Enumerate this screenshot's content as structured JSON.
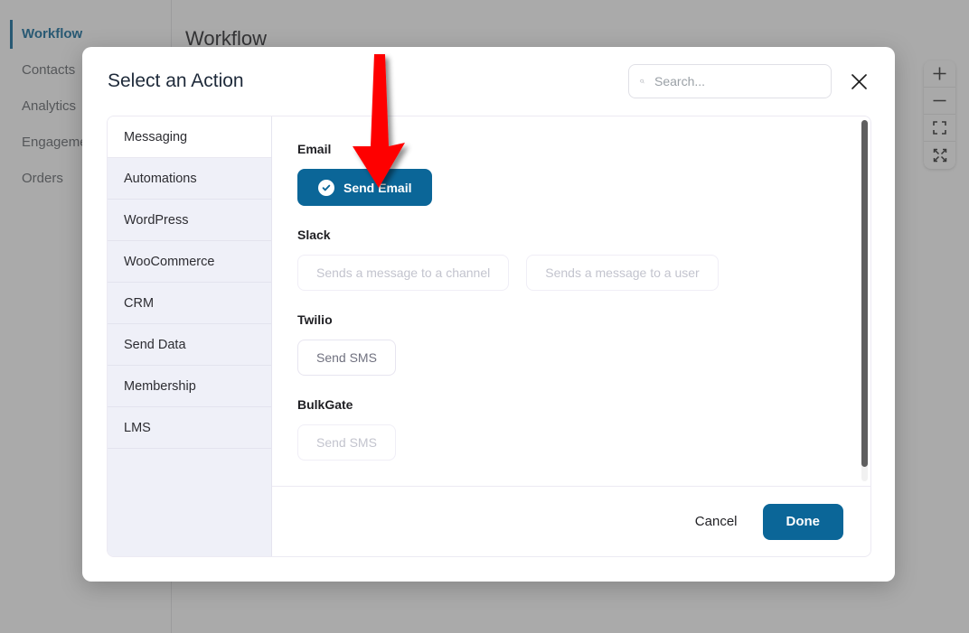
{
  "app": {
    "page_title": "Workflow",
    "sidebar": {
      "items": [
        {
          "label": "Workflow",
          "active": true
        },
        {
          "label": "Contacts",
          "active": false
        },
        {
          "label": "Analytics",
          "active": false
        },
        {
          "label": "Engagement",
          "active": false
        },
        {
          "label": "Orders",
          "active": false
        }
      ]
    },
    "zoom_controls": [
      {
        "name": "zoom-in-icon",
        "glyph": "+"
      },
      {
        "name": "zoom-out-icon",
        "glyph": "−"
      },
      {
        "name": "fit-to-screen-icon",
        "glyph": "⬚"
      },
      {
        "name": "expand-icon",
        "glyph": "⤡"
      }
    ]
  },
  "modal": {
    "title": "Select an Action",
    "search": {
      "placeholder": "Search...",
      "value": ""
    },
    "close_label": "×",
    "tabs": [
      {
        "label": "Messaging",
        "active": true
      },
      {
        "label": "Automations",
        "active": false
      },
      {
        "label": "WordPress",
        "active": false
      },
      {
        "label": "WooCommerce",
        "active": false
      },
      {
        "label": "CRM",
        "active": false
      },
      {
        "label": "Send Data",
        "active": false
      },
      {
        "label": "Membership",
        "active": false
      },
      {
        "label": "LMS",
        "active": false
      }
    ],
    "groups": [
      {
        "label": "Email",
        "actions": [
          {
            "label": "Send Email",
            "state": "selected",
            "icon": "check-circle-icon"
          }
        ]
      },
      {
        "label": "Slack",
        "actions": [
          {
            "label": "Sends a message to a channel",
            "state": "disabled",
            "icon": ""
          },
          {
            "label": "Sends a message to a user",
            "state": "disabled",
            "icon": ""
          }
        ]
      },
      {
        "label": "Twilio",
        "actions": [
          {
            "label": "Send SMS",
            "state": "secondary",
            "icon": ""
          }
        ]
      },
      {
        "label": "BulkGate",
        "actions": [
          {
            "label": "Send SMS",
            "state": "disabled",
            "icon": ""
          }
        ]
      }
    ],
    "footer": {
      "cancel_label": "Cancel",
      "done_label": "Done"
    }
  },
  "annotation": {
    "arrow": "red-down-arrow",
    "points_at": "Send Email"
  },
  "colors": {
    "accent_blue": "#0b6698",
    "tab_active_bg": "#ffffff",
    "tab_bg": "#eff0f8",
    "overlay": "#4a4a4a",
    "arrow_red": "#fe0000"
  }
}
